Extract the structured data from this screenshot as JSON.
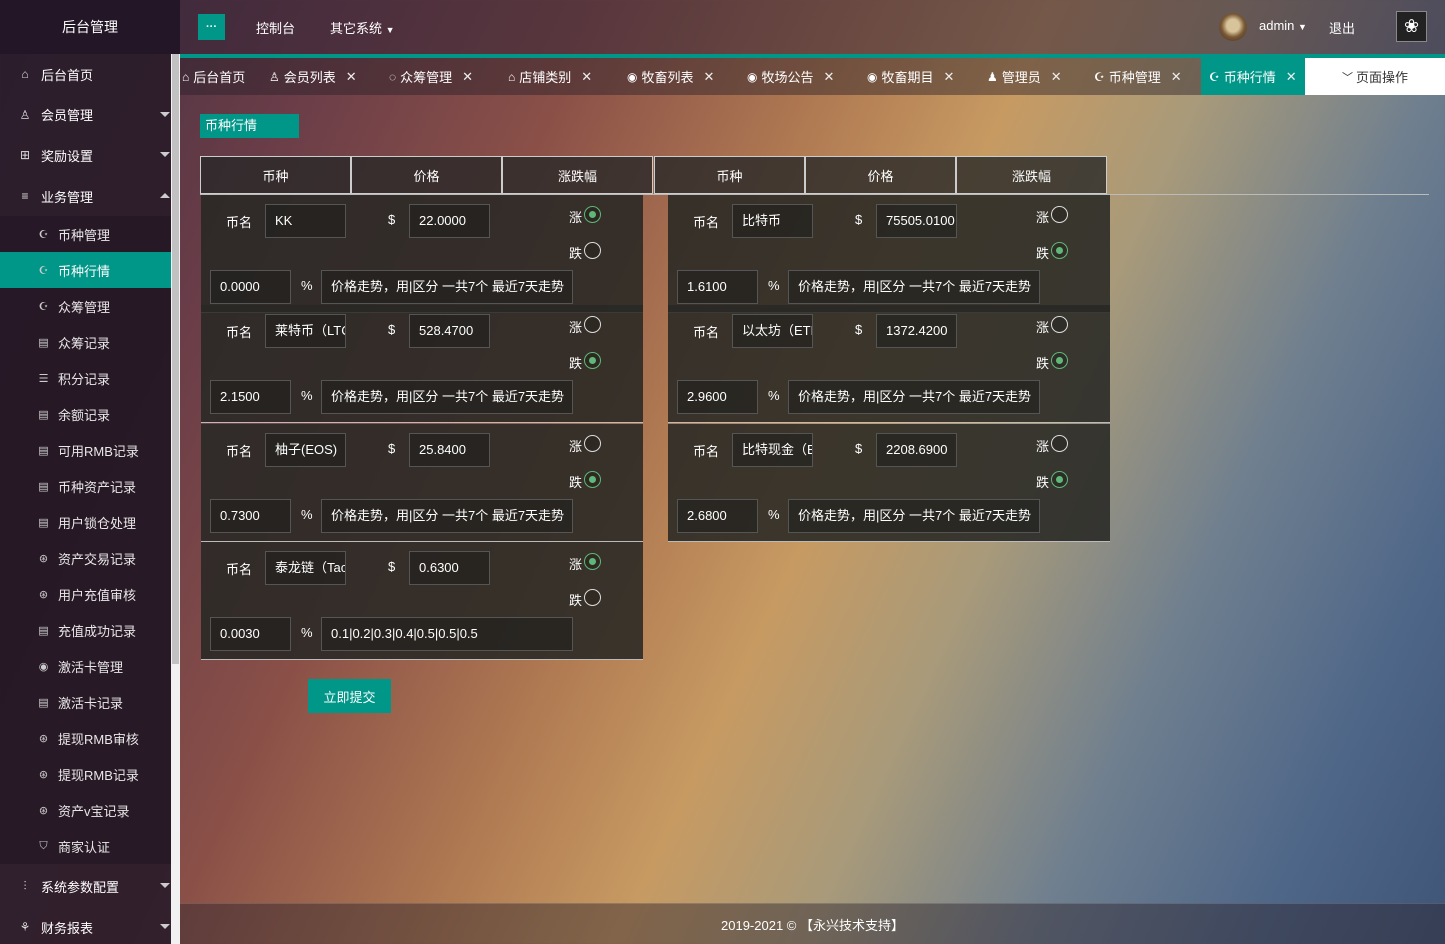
{
  "app_title": "后台管理",
  "topbar": {
    "menu_toggle": "···",
    "console": "控制台",
    "other_systems": "其它系统",
    "user": "admin",
    "logout": "退出"
  },
  "sidebar": {
    "items": [
      {
        "label": "后台首页",
        "icon": "home-icon"
      },
      {
        "label": "会员管理",
        "icon": "user-icon"
      },
      {
        "label": "奖励设置",
        "icon": "gift-icon"
      },
      {
        "label": "业务管理",
        "icon": "list-icon"
      }
    ],
    "sub_items": [
      {
        "label": "币种管理"
      },
      {
        "label": "币种行情"
      },
      {
        "label": "众筹管理"
      },
      {
        "label": "众筹记录"
      },
      {
        "label": "积分记录"
      },
      {
        "label": "余额记录"
      },
      {
        "label": "可用RMB记录"
      },
      {
        "label": "币种资产记录"
      },
      {
        "label": "用户锁仓处理"
      },
      {
        "label": "资产交易记录"
      },
      {
        "label": "用户充值审核"
      },
      {
        "label": "充值成功记录"
      },
      {
        "label": "激活卡管理"
      },
      {
        "label": "激活卡记录"
      },
      {
        "label": "提现RMB审核"
      },
      {
        "label": "提现RMB记录"
      },
      {
        "label": "资产v宝记录"
      },
      {
        "label": "商家认证"
      }
    ],
    "bottom_items": [
      {
        "label": "系统参数配置",
        "icon": "sliders-icon"
      },
      {
        "label": "财务报表",
        "icon": "chart-icon"
      }
    ]
  },
  "tabs": [
    "后台首页",
    "会员列表",
    "众筹管理",
    "店铺类别",
    "牧畜列表",
    "牧场公告",
    "牧畜期目",
    "管理员",
    "币种管理",
    "币种行情"
  ],
  "page_ops": "页面操作",
  "section_title": "币种行情",
  "table_headers": [
    "币种",
    "价格",
    "涨跌幅",
    "币种",
    "价格",
    "涨跌幅"
  ],
  "labels": {
    "coin_name": "币名",
    "currency": "$",
    "percent": "%",
    "up": "涨",
    "down": "跌"
  },
  "coins_left": [
    {
      "name": "KK",
      "price": "22.0000",
      "change": "0.0000",
      "trend": "价格走势，用|区分 一共7个 最近7天走势",
      "direction": "up"
    },
    {
      "name": "莱特币（LTC",
      "price": "528.4700",
      "change": "2.1500",
      "trend": "价格走势，用|区分 一共7个 最近7天走势",
      "direction": "down"
    },
    {
      "name": "柚子(EOS)",
      "price": "25.8400",
      "change": "0.7300",
      "trend": "价格走势，用|区分 一共7个 最近7天走势",
      "direction": "down"
    },
    {
      "name": "泰龙链（Tac",
      "price": "0.6300",
      "change": "0.0030",
      "trend": "0.1|0.2|0.3|0.4|0.5|0.5|0.5",
      "direction": "up"
    }
  ],
  "coins_right": [
    {
      "name": "比特币",
      "price": "75505.0100",
      "change": "1.6100",
      "trend": "价格走势，用|区分 一共7个 最近7天走势",
      "direction": "down"
    },
    {
      "name": "以太坊（ETH",
      "price": "1372.4200",
      "change": "2.9600",
      "trend": "价格走势，用|区分 一共7个 最近7天走势",
      "direction": "down"
    },
    {
      "name": "比特现金（B",
      "price": "2208.6900",
      "change": "2.6800",
      "trend": "价格走势，用|区分 一共7个 最近7天走势",
      "direction": "down"
    }
  ],
  "submit_label": "立即提交",
  "footer": "2019-2021 © 【永兴技术支持】",
  "colors": {
    "accent": "#009688",
    "radio_checked": "#5fb878"
  }
}
